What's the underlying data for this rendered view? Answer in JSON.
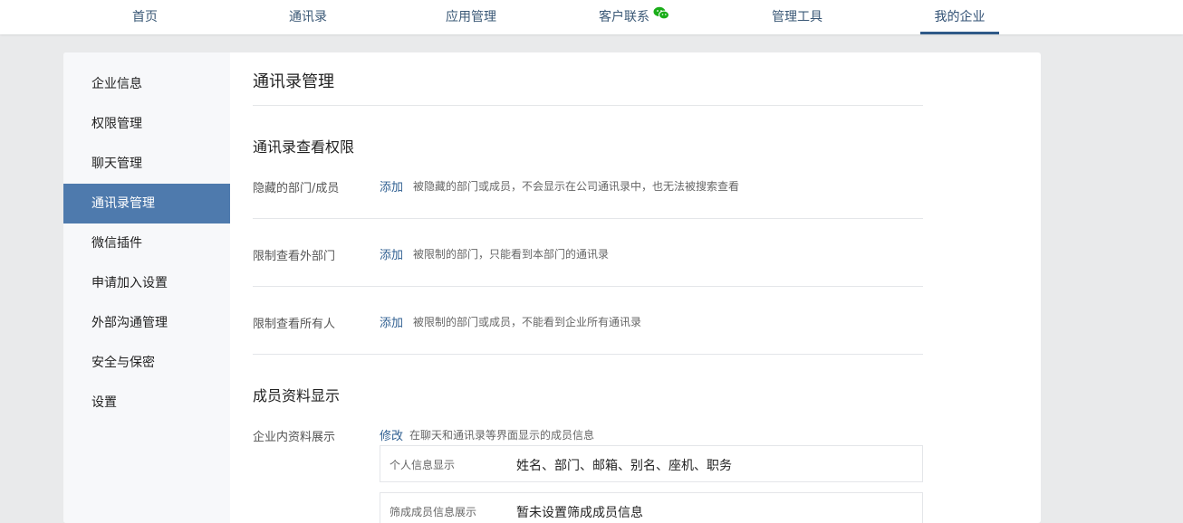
{
  "topnav": {
    "items": [
      {
        "label": "首页"
      },
      {
        "label": "通讯录"
      },
      {
        "label": "应用管理"
      },
      {
        "label": "客户联系"
      },
      {
        "label": "管理工具"
      },
      {
        "label": "我的企业"
      }
    ],
    "active_index": 5,
    "wechat_icon": "wechat-icon",
    "wechat_color": "#1aad19"
  },
  "sidebar": {
    "items": [
      {
        "label": "企业信息"
      },
      {
        "label": "权限管理"
      },
      {
        "label": "聊天管理"
      },
      {
        "label": "通讯录管理"
      },
      {
        "label": "微信插件"
      },
      {
        "label": "申请加入设置"
      },
      {
        "label": "外部沟通管理"
      },
      {
        "label": "安全与保密"
      },
      {
        "label": "设置"
      }
    ],
    "active_index": 3,
    "active_color": "#4e7aad"
  },
  "main": {
    "title": "通讯录管理",
    "permissions": {
      "title": "通讯录查看权限",
      "rows": [
        {
          "label": "隐藏的部门/成员",
          "action": "添加",
          "desc": "被隐藏的部门或成员，不会显示在公司通讯录中，也无法被搜索查看"
        },
        {
          "label": "限制查看外部门",
          "action": "添加",
          "desc": "被限制的部门，只能看到本部门的通讯录"
        },
        {
          "label": "限制查看所有人",
          "action": "添加",
          "desc": "被限制的部门或成员，不能看到企业所有通讯录"
        }
      ]
    },
    "profile": {
      "title": "成员资料显示",
      "row_label": "企业内资料展示",
      "action": "修改",
      "desc": "在聊天和通讯录等界面显示的成员信息",
      "boxes": [
        {
          "label": "个人信息显示",
          "value": "姓名、部门、邮箱、别名、座机、职务"
        },
        {
          "label": "筛成成员信息展示",
          "value": "暂未设置筛成成员信息"
        }
      ]
    },
    "link_color": "#2f5f91"
  }
}
